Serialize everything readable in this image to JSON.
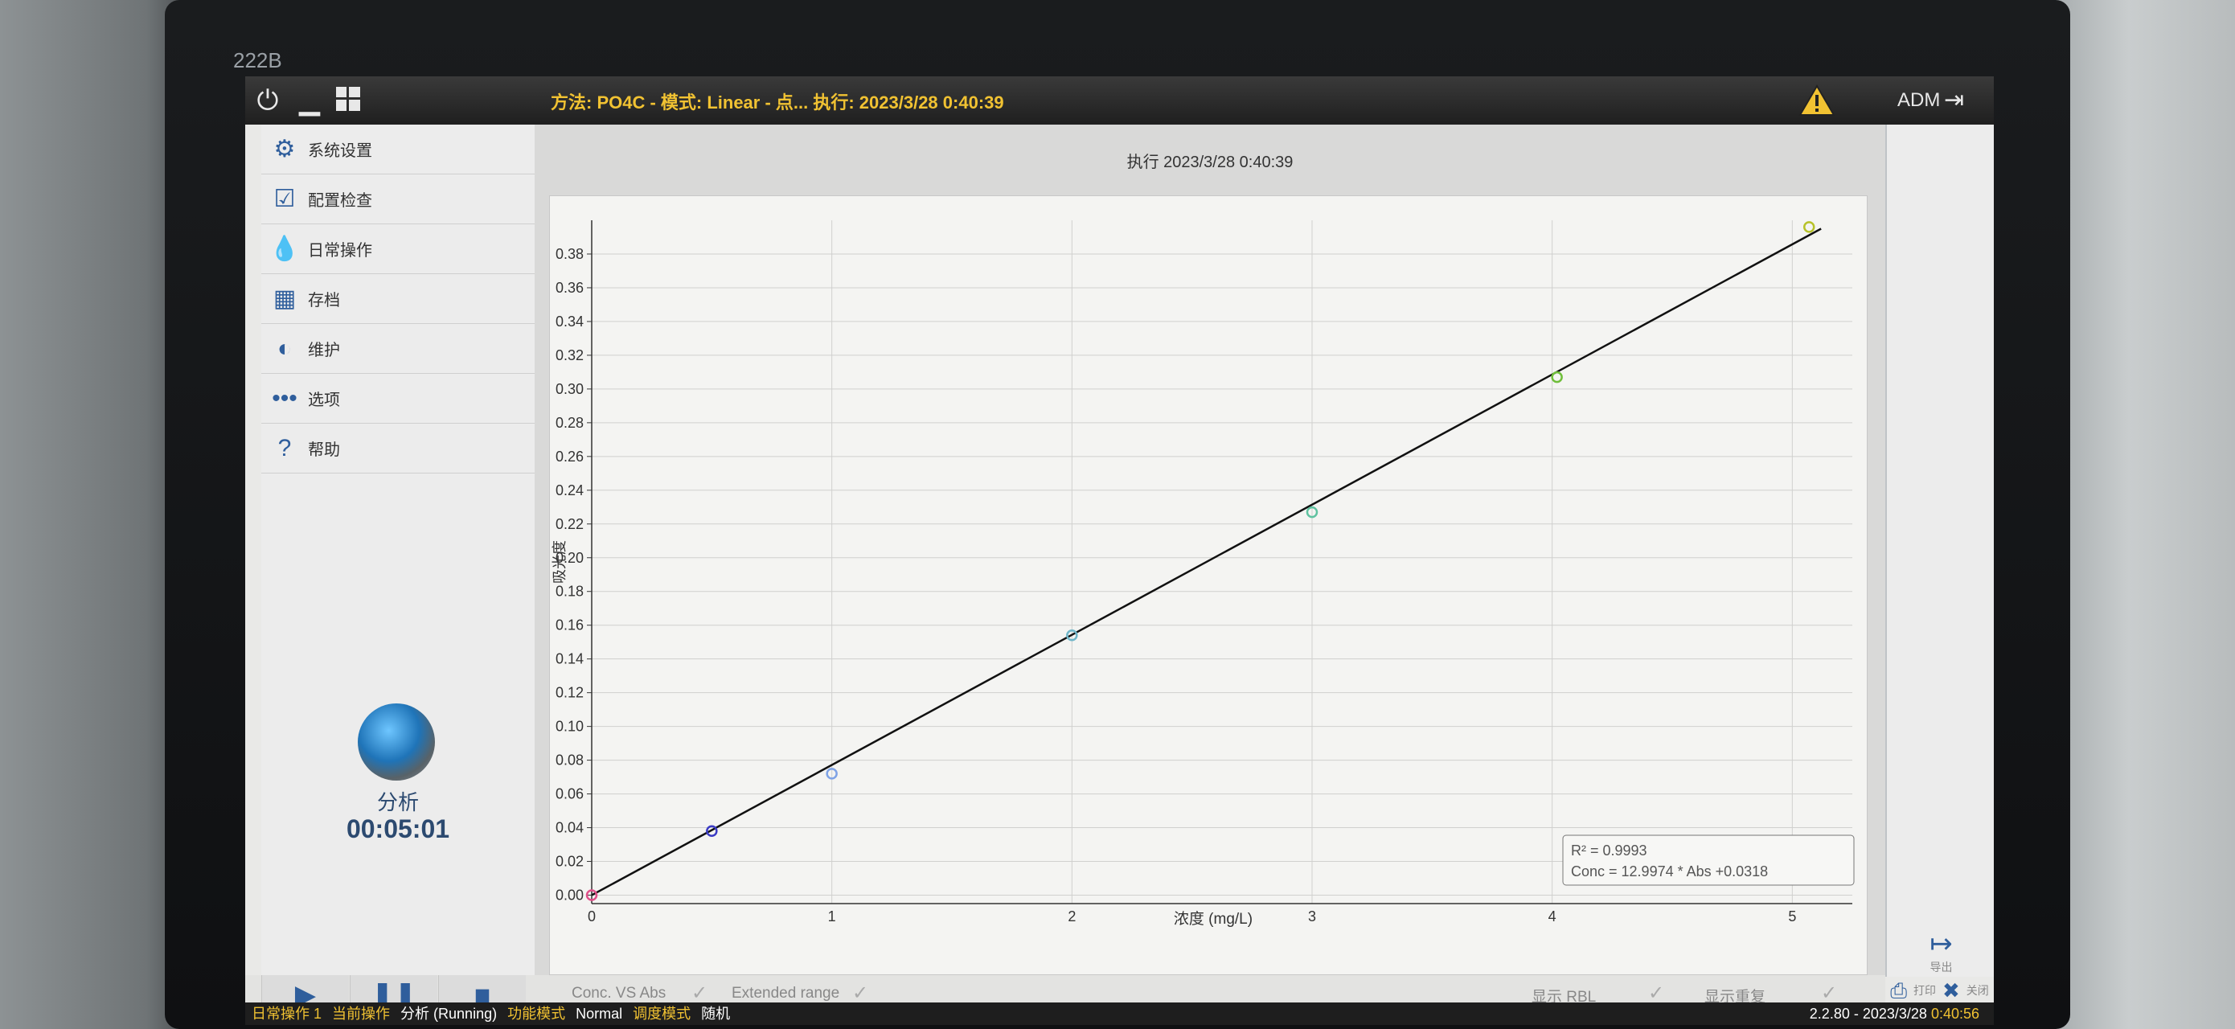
{
  "bezel_label": "222B",
  "topbar": {
    "title": "方法: PO4C - 模式: Linear - 点... 执行: 2023/3/28 0:40:39",
    "user": "ADM"
  },
  "sidebar": {
    "items": [
      {
        "label": "系统设置",
        "icon": "gear-icon"
      },
      {
        "label": "配置检查",
        "icon": "checkbox-icon"
      },
      {
        "label": "日常操作",
        "icon": "droplet-icon"
      },
      {
        "label": "存档",
        "icon": "archive-icon"
      },
      {
        "label": "维护",
        "icon": "maintenance-icon"
      },
      {
        "label": "选项",
        "icon": "more-icon"
      },
      {
        "label": "帮助",
        "icon": "help-icon"
      }
    ],
    "state": "分析",
    "timer": "00:05:01"
  },
  "main": {
    "title": "执行 2023/3/28 0:40:39"
  },
  "chart_data": {
    "type": "scatter",
    "title": "",
    "xlabel": "浓度 (mg/L)",
    "ylabel": "吸光度",
    "xlim": [
      0,
      5.25
    ],
    "ylim": [
      -0.005,
      0.4
    ],
    "xticks": [
      "0",
      "1",
      "2",
      "3",
      "4",
      "5"
    ],
    "yticks": [
      "0.00",
      "0.02",
      "0.04",
      "0.06",
      "0.08",
      "0.10",
      "0.12",
      "0.14",
      "0.16",
      "0.18",
      "0.20",
      "0.22",
      "0.24",
      "0.26",
      "0.28",
      "0.30",
      "0.32",
      "0.34",
      "0.36",
      "0.38"
    ],
    "points": [
      {
        "x": 0.0,
        "y": 0.0,
        "color": "#e0508a"
      },
      {
        "x": 0.5,
        "y": 0.038,
        "color": "#3b3bc4"
      },
      {
        "x": 1.0,
        "y": 0.072,
        "color": "#7fa3e6"
      },
      {
        "x": 2.0,
        "y": 0.154,
        "color": "#6fb5c8"
      },
      {
        "x": 3.0,
        "y": 0.227,
        "color": "#5fc2a0"
      },
      {
        "x": 4.02,
        "y": 0.307,
        "color": "#6fbe3a"
      },
      {
        "x": 5.07,
        "y": 0.396,
        "color": "#b7c22a"
      }
    ],
    "fit_line": {
      "x": [
        0,
        5.12
      ],
      "y": [
        0,
        0.395
      ]
    },
    "grid": true,
    "annotation": [
      "R² = 0.9993",
      "Conc = 12.9974 * Abs +0.0318"
    ]
  },
  "footer": {
    "conc_vs_abs": "Conc. VS Abs",
    "extended_range": "Extended range",
    "show_rbl": "显示 RBL",
    "show_repeat": "显示重复"
  },
  "rail": {
    "export": "导出",
    "print": "打印",
    "close": "关闭"
  },
  "statusbar": {
    "k1": "日常操作 1",
    "k2": "当前操作",
    "v2": "分析 (Running)",
    "k3": "功能模式",
    "v3": "Normal",
    "k4": "调度模式",
    "v4": "随机",
    "version": "2.2.80 - 2023/3/28",
    "time": "0:40:56"
  }
}
